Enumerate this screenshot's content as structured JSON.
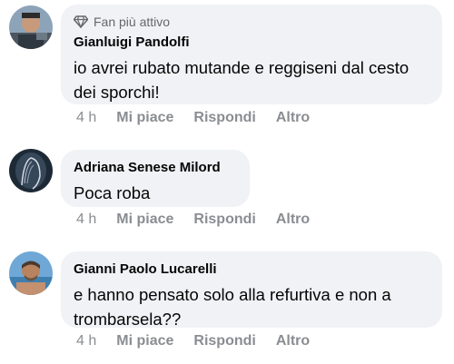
{
  "comments": [
    {
      "badge": "Fan più attivo",
      "author": "Gianluigi Pandolfi",
      "text": "io avrei rubato mutande e reggiseni dal cesto dei sporchi!",
      "time": "4 h",
      "like": "Mi piace",
      "reply": "Rispondi",
      "more": "Altro"
    },
    {
      "author": "Adriana Senese Milord",
      "text": "Poca roba",
      "time": "4 h",
      "like": "Mi piace",
      "reply": "Rispondi",
      "more": "Altro"
    },
    {
      "author": "Gianni Paolo Lucarelli",
      "text": "e hanno pensato solo alla refurtiva e non a trombarsela??",
      "time": "4 h",
      "like": "Mi piace",
      "reply": "Rispondi",
      "more": "Altro"
    }
  ],
  "icons": {
    "badge_icon": "diamond-icon"
  },
  "colors": {
    "bubble": "#f0f2f5",
    "meta": "#8a8d91",
    "badge": "#65676b"
  }
}
